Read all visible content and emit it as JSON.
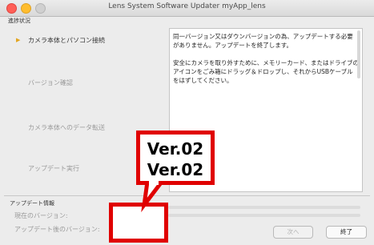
{
  "window": {
    "title": "Lens System Software Updater   myApp_lens"
  },
  "progress": {
    "section_label": "進捗状況",
    "steps": [
      {
        "label": "カメラ本体とパソコン接続",
        "active": true
      },
      {
        "label": "バージョン確認",
        "active": false
      },
      {
        "label": "カメラ本体へのデータ転送",
        "active": false
      },
      {
        "label": "アップデート実行",
        "active": false
      }
    ],
    "current_marker": "▶"
  },
  "message": {
    "paragraphs": [
      "同一バージョン又はダウンバージョンの為、アップデートする必要がありません。アップデートを終了します。",
      "安全にカメラを取り外すために、メモリーカード、またはドライブのアイコンをごみ箱にドラッグ＆ドロップし、それからUSBケーブルをはずしてください。"
    ]
  },
  "update_info": {
    "section_label": "アップデート情報",
    "current_version_label": "現在のバージョン:",
    "after_version_label": "アップデート後のバージョン:"
  },
  "buttons": {
    "next": "次へ",
    "end": "終了"
  },
  "annotation": {
    "current_version": "Ver.02",
    "after_version": "Ver.02",
    "color": "#e00000"
  }
}
